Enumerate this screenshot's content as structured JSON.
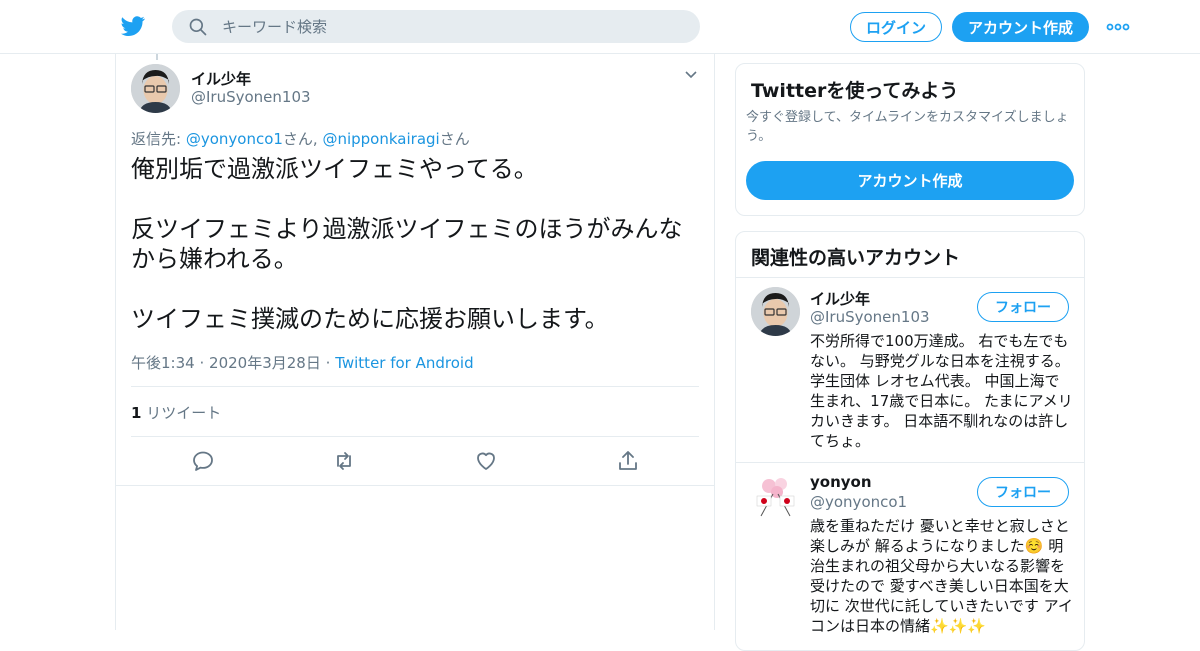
{
  "header": {
    "logo_icon": "twitter-bird-icon",
    "search_placeholder": "キーワード検索",
    "login_label": "ログイン",
    "signup_label": "アカウント作成",
    "more_icon": "more-dots-icon",
    "brand_color": "#1da1f2"
  },
  "tweet": {
    "author_name": "イル少年",
    "author_handle": "@IruSyonen103",
    "reply_prefix": "返信先: ",
    "reply_to_1": "@yonyonco1",
    "reply_suffix_1": "さん, ",
    "reply_to_2": "@nipponkairagi",
    "reply_suffix_2": "さん",
    "text_lines": [
      "俺別垢で過激派ツイフェミやってる。",
      "反ツイフェミより過激派ツイフェミのほうがみんな",
      "から嫌われる。",
      "ツイフェミ撲滅のために応援お願いします。"
    ],
    "time": "午後1:34",
    "date": "2020年3月28日",
    "separator": "·",
    "client": "Twitter for Android",
    "retweet_count": "1",
    "retweet_label": "リツイート",
    "actions": [
      "reply-icon",
      "retweet-icon",
      "like-icon",
      "share-icon"
    ]
  },
  "sidebar": {
    "signup_card": {
      "title": "Twitterを使ってみよう",
      "description": "今すぐ登録して、タイムラインをカスタマイズしましょう。",
      "button_label": "アカウント作成"
    },
    "related": {
      "title": "関連性の高いアカウント",
      "accounts": [
        {
          "name": "イル少年",
          "handle": "@IruSyonen103",
          "follow_label": "フォロー",
          "bio": "不労所得で100万達成。 右でも左でもない。 与野党グルな日本を注視する。 学生団体 レオセム代表。 中国上海で生まれ、17歳で日本に。 たまにアメリカいきます。 日本語不馴れなのは許してちょ。"
        },
        {
          "name": "yonyon",
          "handle": "@yonyonco1",
          "follow_label": "フォロー",
          "bio": "歳を重ねただけ 憂いと幸せと寂しさと楽しみが 解るようになりました☺️ 明治生まれの祖父母から大いなる影響を受けたので 愛すべき美しい日本国を大切に 次世代に託していきたいです アイコンは日本の情緒✨✨✨"
        }
      ]
    }
  }
}
